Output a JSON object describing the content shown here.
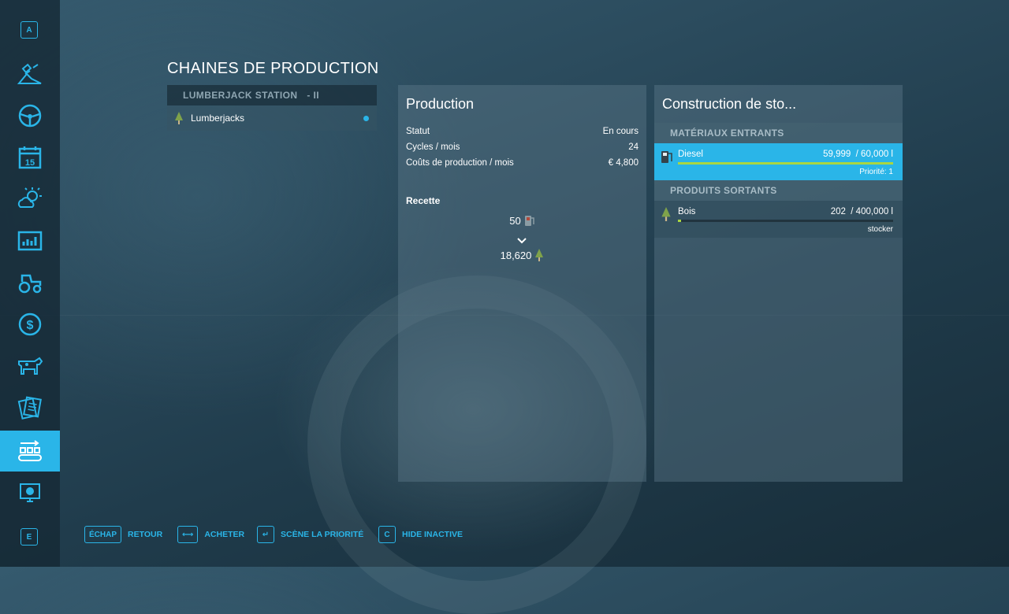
{
  "sidebar": {
    "top_key": "A",
    "bottom_key": "E",
    "items": [
      {
        "icon": "satellite-map-icon"
      },
      {
        "icon": "steering-wheel-icon"
      },
      {
        "icon": "calendar-icon",
        "day": "15"
      },
      {
        "icon": "weather-icon"
      },
      {
        "icon": "statistics-icon"
      },
      {
        "icon": "tractor-icon"
      },
      {
        "icon": "money-icon"
      },
      {
        "icon": "animals-icon"
      },
      {
        "icon": "contracts-icon"
      },
      {
        "icon": "production-icon",
        "active": true
      },
      {
        "icon": "help-icon"
      }
    ]
  },
  "page_title": "CHAINES DE PRODUCTION",
  "production_list": {
    "header": "LUMBERJACK STATION",
    "header_suffix": "- II",
    "items": [
      {
        "label": "Lumberjacks",
        "status_dot": true
      }
    ]
  },
  "production": {
    "title": "Production",
    "stats": [
      {
        "label": "Statut",
        "value": "En cours"
      },
      {
        "label": "Cycles / mois",
        "value": "24"
      },
      {
        "label": "Coûts de production / mois",
        "value": "€ 4,800"
      }
    ],
    "recipe_title": "Recette",
    "recipe_input": "50",
    "recipe_output": "18,620"
  },
  "storage": {
    "title": "Construction de sto...",
    "inputs_header": "MATÉRIAUX ENTRANTS",
    "inputs": [
      {
        "name": "Diesel",
        "amount": "59,999",
        "capacity": "/ 60,000 l",
        "fill": 0.99998,
        "sub": "Priorité: 1"
      }
    ],
    "outputs_header": "PRODUITS SORTANTS",
    "outputs": [
      {
        "name": "Bois",
        "amount": "202",
        "capacity": "/ 400,000 l",
        "fill": 0.0005,
        "sub": "stocker"
      }
    ]
  },
  "actions": [
    {
      "key": "ÉCHAP",
      "label": "RETOUR"
    },
    {
      "key": "⟷",
      "label": "ACHETER"
    },
    {
      "key": "↵",
      "label": "SCÈNE LA PRIORITÉ"
    },
    {
      "key": "C",
      "label": "HIDE INACTIVE"
    }
  ],
  "colors": {
    "accent": "#2ab5e8",
    "fill_bar": "#a9d641"
  }
}
